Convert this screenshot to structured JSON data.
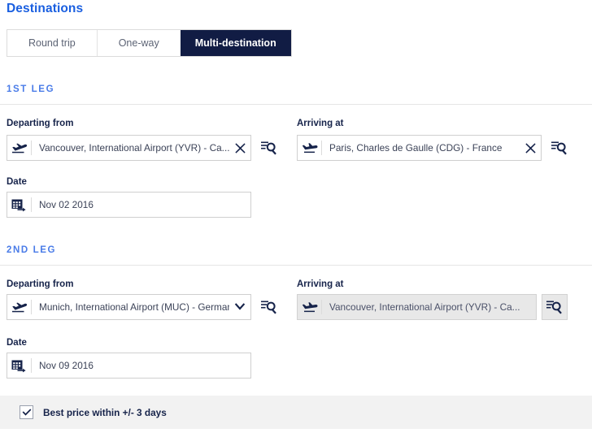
{
  "page": {
    "title": "Destinations"
  },
  "trip_type_tabs": [
    {
      "label": "Round trip",
      "active": false
    },
    {
      "label": "One-way",
      "active": false
    },
    {
      "label": "Multi-destination",
      "active": true
    }
  ],
  "legs": [
    {
      "section_title": "1ST LEG",
      "departing": {
        "label": "Departing from",
        "value": "Vancouver, International Airport (YVR) - Ca...",
        "icon": "plane-takeoff-icon",
        "action_icon": "close-icon",
        "disabled": false
      },
      "arriving": {
        "label": "Arriving at",
        "value": "Paris, Charles de Gaulle (CDG) - France",
        "icon": "plane-landing-icon",
        "action_icon": "close-icon",
        "disabled": false
      },
      "date": {
        "label": "Date",
        "value": "Nov 02 2016",
        "icon": "calendar-icon"
      }
    },
    {
      "section_title": "2ND LEG",
      "departing": {
        "label": "Departing from",
        "value": "Munich, International Airport (MUC) - German",
        "icon": "plane-takeoff-icon",
        "action_icon": "chevron-down-icon",
        "disabled": false
      },
      "arriving": {
        "label": "Arriving at",
        "value": "Vancouver, International Airport (YVR) - Ca...",
        "icon": "plane-landing-icon",
        "action_icon": "none",
        "disabled": true
      },
      "date": {
        "label": "Date",
        "value": "Nov 09 2016",
        "icon": "calendar-icon"
      }
    }
  ],
  "search_button": {
    "icon": "list-search-icon",
    "title": "Search airports"
  },
  "best_price": {
    "label": "Best price within +/- 3 days",
    "checked": true,
    "check_icon": "check-icon"
  },
  "colors": {
    "title_blue": "#1a5fe0",
    "leg_blue": "#4a7ce8",
    "active_tab": "#111c44",
    "text_navy": "#16234a",
    "banner_grey": "#f2f2f2",
    "disabled_grey": "#e8e8e8"
  }
}
